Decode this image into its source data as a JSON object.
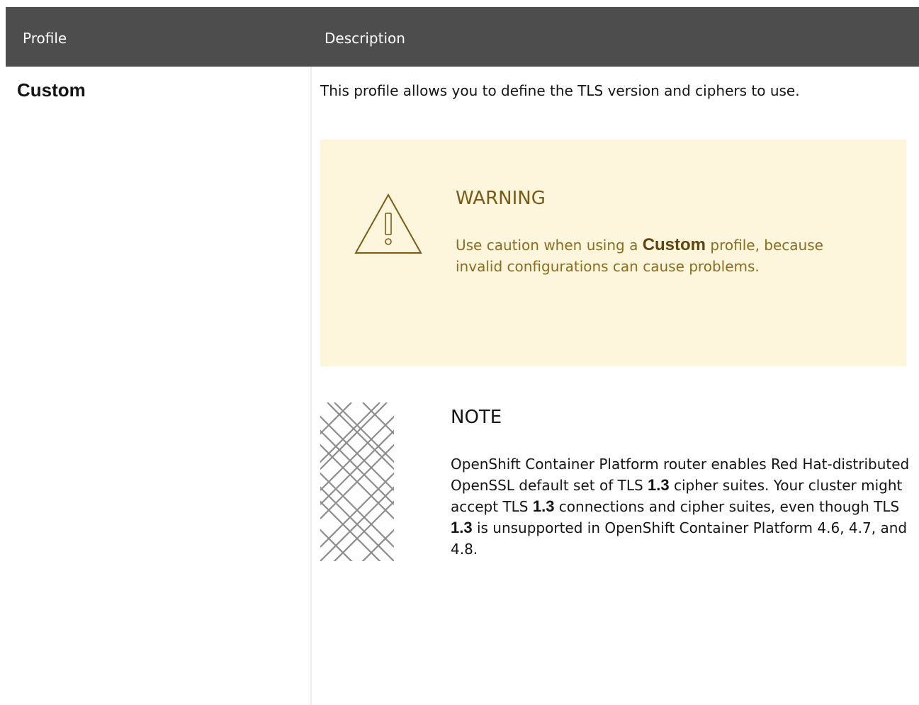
{
  "table": {
    "headers": {
      "profile": "Profile",
      "description": "Description"
    },
    "row": {
      "profile": "Custom",
      "description": "This profile allows you to define the TLS version and ciphers to use."
    }
  },
  "warning": {
    "icon": "warning-triangle-icon",
    "title": "WARNING",
    "body_before": "Use caution when using a ",
    "body_bold": "Custom",
    "body_after": " profile, because invalid configurations can cause problems."
  },
  "note": {
    "icon": "note-pattern-icon",
    "title": "NOTE",
    "seg1": "OpenShift Container Platform router enables Red Hat-distributed OpenSSL default set of TLS ",
    "bold1": "1.3",
    "seg2": " cipher suites. Your cluster might accept TLS ",
    "bold2": "1.3",
    "seg3": " connections and cipher suites, even though TLS ",
    "bold3": "1.3",
    "seg4": " is unsupported in OpenShift Container Platform 4.6, 4.7, and 4.8."
  },
  "colors": {
    "header_bg": "#4d4d4d",
    "warning_bg": "#fdf5dc",
    "warning_text": "#8a6d1f"
  }
}
